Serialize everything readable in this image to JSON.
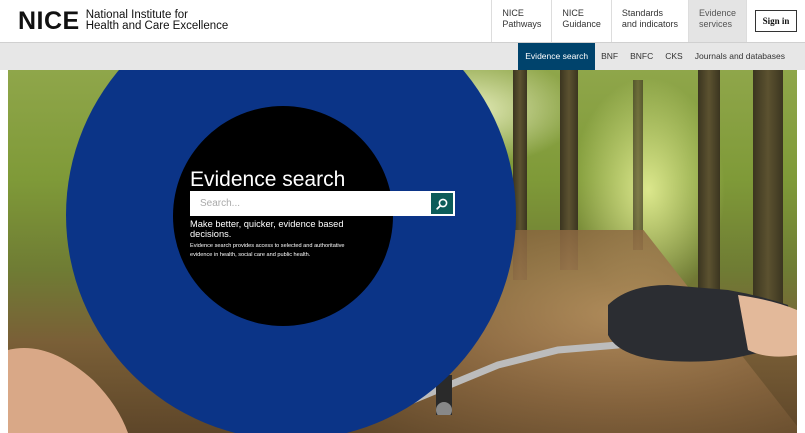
{
  "header": {
    "logo_mark": "NICE",
    "logo_line1": "National Institute for",
    "logo_line2": "Health and Care Excellence",
    "nav": [
      {
        "line1": "NICE",
        "line2": "Pathways"
      },
      {
        "line1": "NICE",
        "line2": "Guidance"
      },
      {
        "line1": "Standards",
        "line2": "and indicators"
      },
      {
        "line1": "Evidence",
        "line2": "services"
      }
    ],
    "signin_label": "Sign in"
  },
  "subnav": {
    "items": [
      "Evidence search",
      "BNF",
      "BNFC",
      "CKS",
      "Journals and databases"
    ]
  },
  "hero": {
    "title": "Evidence search",
    "search_placeholder": "Search...",
    "tagline": "Make better, quicker, evidence based decisions.",
    "description": "Evidence search provides access to selected and authoritative evidence in health, social care and public health."
  },
  "colors": {
    "blue_circle": "#0b3487",
    "subnav_active": "#00436c",
    "search_button": "#0c5c5a"
  },
  "icons": {
    "search": "search-icon"
  }
}
